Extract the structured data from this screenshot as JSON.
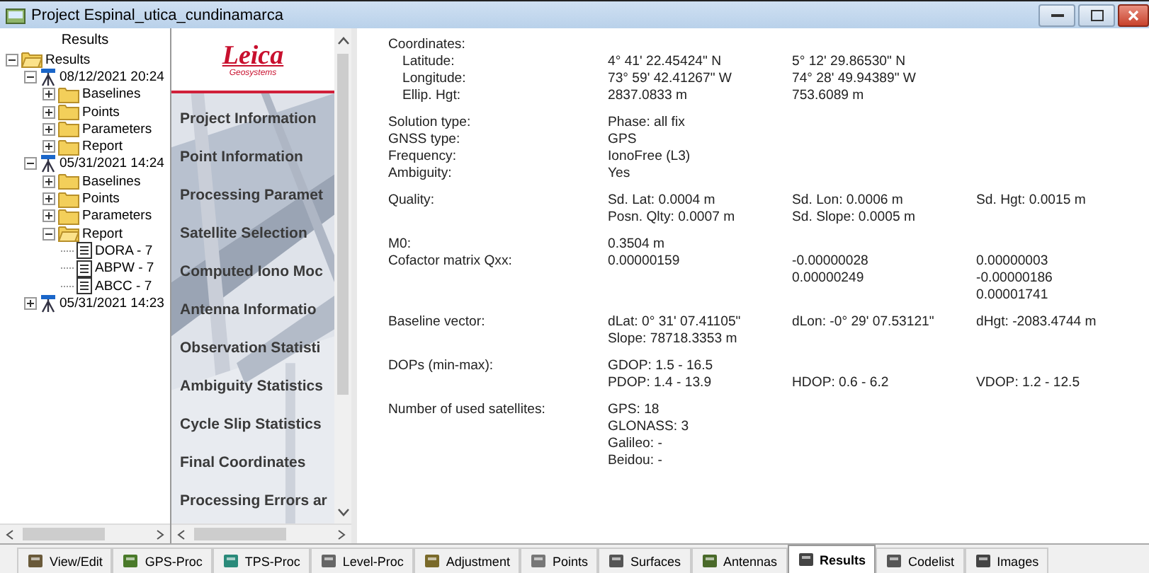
{
  "window": {
    "title": "Project Espinal_utica_cundinamarca"
  },
  "tree": {
    "heading": "Results",
    "items": [
      {
        "label": "Results",
        "kind": "folder",
        "expanded": true,
        "children": [
          {
            "label": "08/12/2021 20:24",
            "kind": "station",
            "expanded": true,
            "children": [
              {
                "label": "Baselines",
                "kind": "folder",
                "expanded": false
              },
              {
                "label": "Points",
                "kind": "folder",
                "expanded": false
              },
              {
                "label": "Parameters",
                "kind": "folder",
                "expanded": false
              },
              {
                "label": "Report",
                "kind": "folder",
                "expanded": false
              }
            ]
          },
          {
            "label": "05/31/2021 14:24",
            "kind": "station",
            "expanded": true,
            "children": [
              {
                "label": "Baselines",
                "kind": "folder",
                "expanded": false
              },
              {
                "label": "Points",
                "kind": "folder",
                "expanded": false
              },
              {
                "label": "Parameters",
                "kind": "folder",
                "expanded": false
              },
              {
                "label": "Report",
                "kind": "folder",
                "expanded": true,
                "children": [
                  {
                    "label": "DORA - 7",
                    "kind": "report"
                  },
                  {
                    "label": "ABPW - 7",
                    "kind": "report"
                  },
                  {
                    "label": "ABCC - 7",
                    "kind": "report"
                  }
                ]
              }
            ]
          },
          {
            "label": "05/31/2021 14:23",
            "kind": "station",
            "expanded": false
          }
        ]
      }
    ]
  },
  "nav": {
    "logo": "Leica",
    "tagline": "Geosystems",
    "items": [
      "Project Information",
      "Point Information",
      "Processing Paramet",
      "Satellite Selection",
      "Computed Iono Moc",
      "Antenna Informatio",
      "Observation Statisti",
      "Ambiguity Statistics",
      "Cycle Slip Statistics",
      "Final Coordinates",
      "Processing Errors ar"
    ]
  },
  "content": {
    "groups": [
      [
        {
          "kind": "heading",
          "label": "Coordinates:"
        },
        {
          "kind": "sub",
          "label": "Latitude:",
          "cols": [
            [
              "4° 41' 22.45424\" N"
            ],
            [
              "5° 12' 29.86530\" N"
            ]
          ]
        },
        {
          "kind": "sub",
          "label": "Longitude:",
          "cols": [
            [
              "73° 59' 42.41267\" W"
            ],
            [
              "74° 28' 49.94389\" W"
            ]
          ]
        },
        {
          "kind": "sub",
          "label": "Ellip. Hgt:",
          "cols": [
            [
              "2837.0833 m"
            ],
            [
              "753.6089 m"
            ]
          ]
        }
      ],
      [
        {
          "kind": "field",
          "label": "Solution type:",
          "cols": [
            [
              "Phase: all fix"
            ]
          ]
        },
        {
          "kind": "field",
          "label": "GNSS type:",
          "cols": [
            [
              "GPS"
            ]
          ]
        },
        {
          "kind": "field",
          "label": "Frequency:",
          "cols": [
            [
              "IonoFree (L3)"
            ]
          ]
        },
        {
          "kind": "field",
          "label": "Ambiguity:",
          "cols": [
            [
              "Yes"
            ]
          ]
        }
      ],
      [
        {
          "kind": "field",
          "label": "Quality:",
          "cols": [
            [
              "Sd. Lat: 0.0004 m",
              "Posn. Qlty: 0.0007 m"
            ],
            [
              "Sd. Lon: 0.0006 m",
              "Sd. Slope: 0.0005 m"
            ],
            [
              "Sd. Hgt: 0.0015 m"
            ]
          ]
        }
      ],
      [
        {
          "kind": "field",
          "label": "M0:",
          "cols": [
            [
              "0.3504 m"
            ]
          ]
        },
        {
          "kind": "field",
          "label": "Cofactor matrix Qxx:",
          "cols": [
            [
              "0.00000159"
            ],
            [
              "-0.00000028",
              "0.00000249"
            ],
            [
              "0.00000003",
              "-0.00000186",
              "0.00001741"
            ]
          ]
        }
      ],
      [
        {
          "kind": "field",
          "label": "Baseline vector:",
          "cols": [
            [
              "dLat: 0° 31' 07.41105\"",
              "Slope: 78718.3353 m"
            ],
            [
              "dLon: -0° 29' 07.53121\""
            ],
            [
              "dHgt: -2083.4744 m"
            ]
          ]
        }
      ],
      [
        {
          "kind": "field",
          "label": "DOPs (min-max):",
          "cols": [
            [
              "GDOP: 1.5 - 16.5",
              "PDOP: 1.4 - 13.9"
            ],
            [
              "HDOP: 0.6 - 6.2"
            ],
            [
              "VDOP: 1.2 - 12.5"
            ]
          ],
          "later_cols_start_on_second_line": true
        }
      ],
      [
        {
          "kind": "field",
          "label": "Number of used satellites:",
          "cols": [
            [
              "GPS:  18",
              "GLONASS:  3",
              "Galileo:  -",
              "Beidou:  -"
            ]
          ]
        }
      ]
    ]
  },
  "tabs": [
    {
      "label": "View/Edit",
      "selected": false
    },
    {
      "label": "GPS-Proc",
      "selected": false
    },
    {
      "label": "TPS-Proc",
      "selected": false
    },
    {
      "label": "Level-Proc",
      "selected": false
    },
    {
      "label": "Adjustment",
      "selected": false
    },
    {
      "label": "Points",
      "selected": false
    },
    {
      "label": "Surfaces",
      "selected": false
    },
    {
      "label": "Antennas",
      "selected": false
    },
    {
      "label": "Results",
      "selected": true
    },
    {
      "label": "Codelist",
      "selected": false
    },
    {
      "label": "Images",
      "selected": false
    }
  ]
}
